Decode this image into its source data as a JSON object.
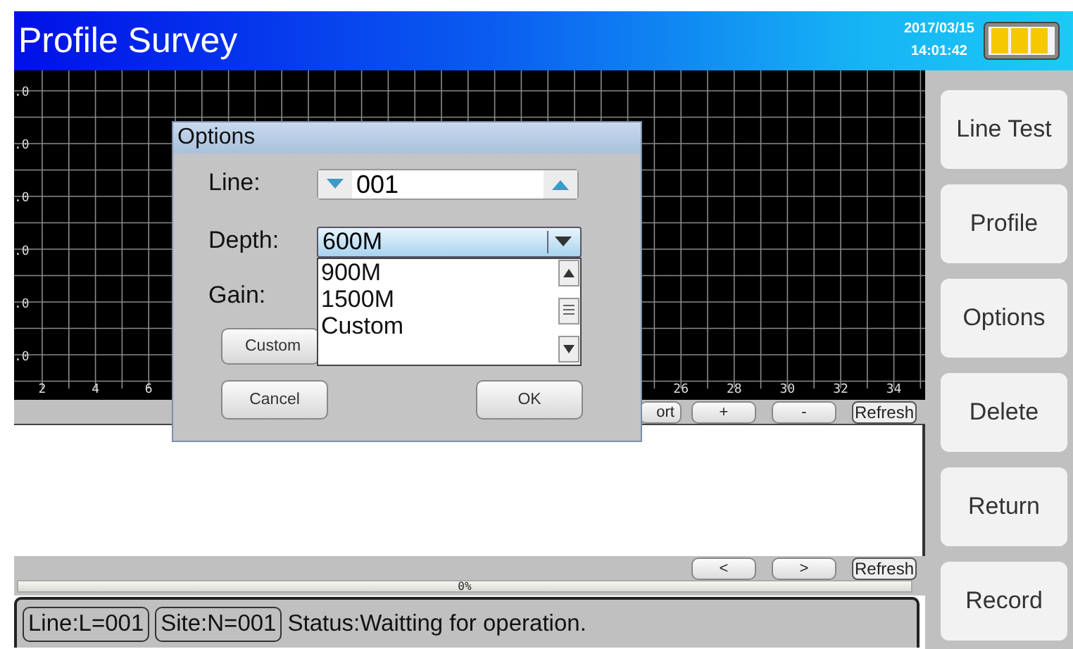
{
  "window": {
    "title": "Profile Survey",
    "date": "2017/03/15",
    "time": "14:01:42"
  },
  "chart": {
    "y_labels": [
      ".0",
      ".0",
      ".0",
      ".0",
      ".0",
      ".0"
    ],
    "x_labels": [
      "2",
      "4",
      "6",
      "26",
      "28",
      "30",
      "32",
      "34"
    ]
  },
  "chart_buttons": [
    "ort",
    "+",
    "-",
    "Refresh"
  ],
  "result_buttons": [
    "<",
    ">",
    "Refresh"
  ],
  "progress": {
    "level": 0,
    "reading": "0%"
  },
  "status": {
    "line": "Line:L=001",
    "site": "Site:N=001",
    "message": "Status:Waitting for operation."
  },
  "sidebar": [
    "Line Test",
    "Profile",
    "Options",
    "Delete",
    "Return",
    "Record"
  ],
  "dialog": {
    "title": "Options",
    "line_label": "Line:",
    "line_value": "001",
    "depth_label": "Depth:",
    "depth_value": "600M",
    "expanded": true,
    "depth_options": [
      {
        "label": "900M",
        "selected": false
      },
      {
        "label": "1500M",
        "selected": false
      },
      {
        "label": "Custom",
        "selected": false
      }
    ],
    "gain_label": "Gain:",
    "custom_button": "Custom",
    "cancel": "Cancel",
    "ok": "OK"
  }
}
